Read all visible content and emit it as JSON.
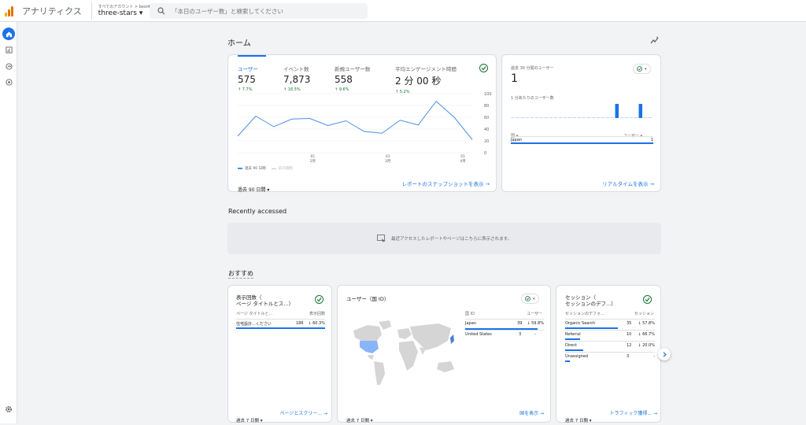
{
  "app": {
    "name": "アナリティクス",
    "crumb": "すべてのアカウント > best4life",
    "property": "three-stars"
  },
  "search": {
    "placeholder": "「本日のユーザー数」と検索してください"
  },
  "colors": {
    "accent": "#1a73e8",
    "positive": "#137333",
    "logo_dark": "#e37400",
    "logo_light": "#f9ab00"
  },
  "nav": [
    {
      "icon": "home-icon"
    },
    {
      "icon": "reports-icon"
    },
    {
      "icon": "explore-icon"
    },
    {
      "icon": "advertising-icon"
    },
    {
      "icon": "settings-icon"
    }
  ],
  "home": {
    "title": "ホーム"
  },
  "overview": {
    "kpis": [
      {
        "label": "ユーザー",
        "value": "575",
        "change": "7.7%"
      },
      {
        "label": "イベント数",
        "value": "7,873",
        "change": "16.5%"
      },
      {
        "label": "新規ユーザー数",
        "value": "558",
        "change": "9.6%"
      },
      {
        "label": "平均エンゲージメント時間",
        "value": "2 分 00 秒",
        "change": "5.2%"
      }
    ],
    "legend_current": "過去 90 日間",
    "legend_previous": "前の期間",
    "date_range": "過去 90 日間",
    "snapshot_link": "レポートのスナップショットを表示 →"
  },
  "chart_data": {
    "type": "line",
    "ylim": [
      0,
      100
    ],
    "yticks": [
      "100",
      "80",
      "60",
      "40",
      "20",
      "0"
    ],
    "xticks": [
      {
        "day": "01",
        "month": "2月"
      },
      {
        "day": "01",
        "month": "3月"
      },
      {
        "day": "01",
        "month": "4月"
      }
    ],
    "series": [
      {
        "name": "過去 90 日間",
        "values": [
          28,
          62,
          44,
          57,
          58,
          46,
          54,
          36,
          33,
          55,
          47,
          87,
          60,
          22
        ]
      }
    ]
  },
  "realtime": {
    "label": "過去 30 分間のユーザー",
    "value": "1",
    "per_minute_label": "1 分あたりのユーザー数",
    "minute_values": [
      0,
      0,
      0,
      0,
      0,
      0,
      0,
      0,
      0,
      0,
      0,
      0,
      0,
      0,
      0,
      0,
      0,
      0,
      0,
      0,
      0,
      0,
      1,
      0,
      0,
      0,
      0,
      1,
      0,
      0
    ],
    "country_dropdown": "国",
    "user_dropdown": "ユーザー",
    "rows": [
      {
        "name": "Japan",
        "value": "1"
      }
    ],
    "link": "リアルタイムを表示 →"
  },
  "recent": {
    "title": "Recently accessed",
    "empty_message": "最近アクセスしたレポートやページはこちらに表示されます。"
  },
  "recommended": {
    "title": "おすすめ",
    "pages_card": {
      "title_line1": "表示回数（",
      "title_line2": "ページ タイトルとス...）",
      "col1": "ページ タイトルと...",
      "col2": "表示回数",
      "rows": [
        {
          "name": "住宅設計...ください",
          "value": "186",
          "change": "60.3%"
        }
      ],
      "date_range": "過去 7 日間",
      "link": "ページとスクリー... →"
    },
    "geo_card": {
      "title": "ユーザー（国 ID）",
      "col1": "国 ID",
      "col2": "ユーザー",
      "rows": [
        {
          "name": "Japan",
          "value": "39",
          "change": "59.8%"
        },
        {
          "name": "United States",
          "value": "3",
          "change": "-"
        }
      ],
      "date_range": "過去 7 日間",
      "link": "国を表示 →"
    },
    "sessions_card": {
      "title_line1": "セッション（",
      "title_line2": "セッションのデフ...）",
      "col1": "セッションのデフォ...",
      "col2": "セッション",
      "rows": [
        {
          "name": "Organic Search",
          "value": "35",
          "change": "57.8%",
          "bar": 0.88
        },
        {
          "name": "Referral",
          "value": "10",
          "change": "66.7%",
          "bar": 0.25
        },
        {
          "name": "Direct",
          "value": "12",
          "change": "20.0%",
          "bar": 0.3
        },
        {
          "name": "Unassigned",
          "value": "3",
          "change": "-",
          "bar": 0.08
        }
      ],
      "date_range": "過去 7 日間",
      "link": "トラフィック獲得... →"
    }
  }
}
